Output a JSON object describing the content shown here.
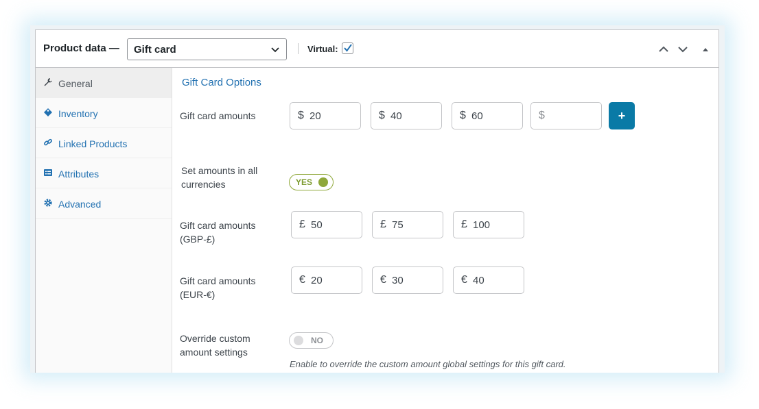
{
  "header": {
    "title": "Product data —",
    "product_type": "Gift card",
    "virtual_label": "Virtual:",
    "virtual_checked": true
  },
  "sidebar": {
    "tabs": [
      {
        "label": "General",
        "icon": "wrench-icon",
        "active": true
      },
      {
        "label": "Inventory",
        "icon": "tag-icon",
        "active": false
      },
      {
        "label": "Linked Products",
        "icon": "link-icon",
        "active": false
      },
      {
        "label": "Attributes",
        "icon": "list-icon",
        "active": false
      },
      {
        "label": "Advanced",
        "icon": "gear-icon",
        "active": false
      }
    ]
  },
  "main": {
    "section_title": "Gift Card Options",
    "amounts": {
      "label": "Gift card amounts",
      "currency": "$",
      "values": [
        "20",
        "40",
        "60"
      ],
      "empty_placeholder": "$",
      "add_label": "+"
    },
    "all_currencies": {
      "label_line1": "Set amounts in all",
      "label_line2": "currencies",
      "toggle": "YES"
    },
    "gbp": {
      "label_line1": "Gift card amounts",
      "label_line2": "(GBP-£)",
      "currency": "£",
      "values": [
        "50",
        "75",
        "100"
      ]
    },
    "eur": {
      "label_line1": "Gift card amounts",
      "label_line2": "(EUR-€)",
      "currency": "€",
      "values": [
        "20",
        "30",
        "40"
      ]
    },
    "override": {
      "label_line1": "Override custom",
      "label_line2": "amount settings",
      "toggle": "NO",
      "description": "Enable to override the custom amount global settings for this gift card."
    }
  },
  "colors": {
    "link": "#2271b1",
    "accent_button": "#0a7aa6",
    "toggle_on": "#8fa83a"
  }
}
